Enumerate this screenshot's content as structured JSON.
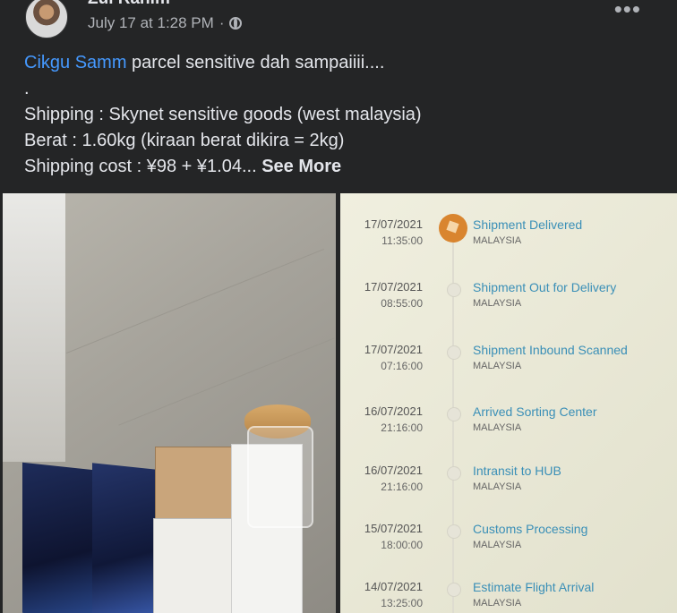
{
  "post": {
    "author": "Zul Rahim",
    "timestamp": "July 17 at 1:28 PM",
    "separator": "·",
    "privacy_icon": "public-globe-icon",
    "more_icon": "•••"
  },
  "caption": {
    "mention": "Cikgu Samm",
    "line1_rest": " parcel sensitive dah sampaiiii....",
    "line2": ".",
    "line3": "Shipping : Skynet sensitive goods (west malaysia)",
    "line4": "Berat : 1.60kg (kiraan berat dikira = 2kg)",
    "line5": "Shipping cost : ¥98 + ¥1.04...",
    "see_more": "See More"
  },
  "photos": [
    {
      "kind": "parcel-boxes-photo"
    },
    {
      "kind": "tracking-timeline-photo"
    }
  ],
  "tracking": {
    "events": [
      {
        "date": "17/07/2021",
        "time": "11:35:00",
        "status": "Shipment Delivered",
        "country": "MALAYSIA",
        "active": true
      },
      {
        "date": "17/07/2021",
        "time": "08:55:00",
        "status": "Shipment Out for Delivery",
        "country": "MALAYSIA",
        "active": false
      },
      {
        "date": "17/07/2021",
        "time": "07:16:00",
        "status": "Shipment Inbound Scanned",
        "country": "MALAYSIA",
        "active": false
      },
      {
        "date": "16/07/2021",
        "time": "21:16:00",
        "status": "Arrived Sorting Center",
        "country": "MALAYSIA",
        "active": false
      },
      {
        "date": "16/07/2021",
        "time": "21:16:00",
        "status": "Intransit to HUB",
        "country": "MALAYSIA",
        "active": false
      },
      {
        "date": "15/07/2021",
        "time": "18:00:00",
        "status": "Customs Processing",
        "country": "MALAYSIA",
        "active": false
      },
      {
        "date": "14/07/2021",
        "time": "13:25:00",
        "status": "Estimate Flight Arrival",
        "country": "MALAYSIA",
        "active": false
      }
    ]
  }
}
